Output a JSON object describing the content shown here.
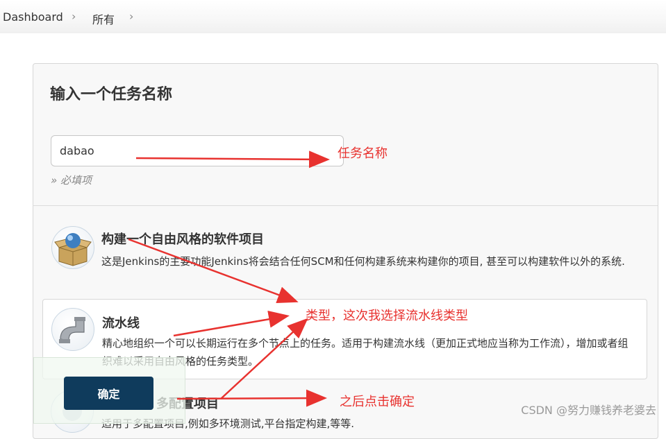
{
  "breadcrumb": {
    "items": [
      "Dashboard",
      "所有"
    ]
  },
  "form": {
    "title": "输入一个任务名称",
    "item_name_value": "dabao",
    "required_hint": "» 必填项"
  },
  "job_types": [
    {
      "name": "构建一个自由风格的软件项目",
      "description": "这是Jenkins的主要功能Jenkins将会结合任何SCM和任何构建系统来构建你的项目, 甚至可以构建软件以外的系统.",
      "icon": "freestyle-box-icon"
    },
    {
      "name": "流水线",
      "description": "精心地组织一个可以长期运行在多个节点上的任务。适用于构建流水线（更加正式地应当称为工作流），增加或者组织难以采用自由风格的任务类型。",
      "icon": "pipeline-pipe-icon"
    },
    {
      "name": "多配置项目",
      "description": "适用于多配置项目,例如多环境测试,平台指定构建,等等.",
      "icon": "multi-config-icon"
    }
  ],
  "actions": {
    "ok_label": "确定"
  },
  "annotations": {
    "task_name": "任务名称",
    "type": "类型，这次我选择流水线类型",
    "then_ok": "之后点击确定",
    "color": "#e8322f"
  },
  "watermark": "CSDN @努力赚钱养老婆去"
}
